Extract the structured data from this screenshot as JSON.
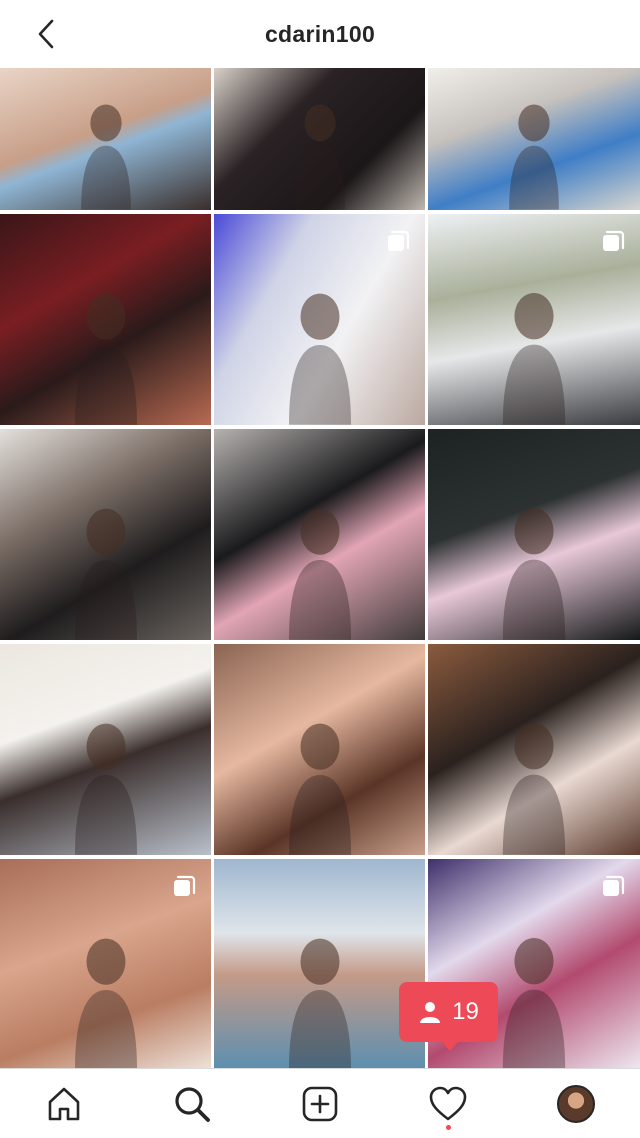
{
  "header": {
    "username": "cdarin100",
    "back_icon": "chevron-left-icon"
  },
  "grid": {
    "tiles": [
      {
        "bg": "linear-gradient(160deg,#e9d4c6 0%,#c89f88 45%,#8fb5d4 55%,#3a2e2a 100%)",
        "multi": false
      },
      {
        "bg": "linear-gradient(135deg,#d8d0c8 0%,#2a2224 35%,#1b1618 70%,#bfb8b0 100%)",
        "multi": false
      },
      {
        "bg": "linear-gradient(160deg,#f1efea 0%,#c7c2bd 35%,#3f7ec6 65%,#d9d6d0 100%)",
        "multi": false
      },
      {
        "bg": "linear-gradient(150deg,#3a1618 0%,#7a1e22 35%,#2a1a1a 60%,#b86a52 100%)",
        "multi": false
      },
      {
        "bg": "linear-gradient(120deg,#4a4ad8 0%,#cfd3e6 30%,#f2f2f4 60%,#bba8a0 100%)",
        "multi": true
      },
      {
        "bg": "linear-gradient(170deg,#eef1f4 0%,#a9b09a 35%,#e6e7e8 60%,#3a3c40 100%)",
        "multi": true
      },
      {
        "bg": "linear-gradient(150deg,#e4e0dc 0%,#7b6e66 35%,#1e1c1d 65%,#6b6560 100%)",
        "multi": false
      },
      {
        "bg": "linear-gradient(150deg,#b6b2b0 0%,#1a1a1c 40%,#e2a5b5 60%,#3f3b3a 100%)",
        "multi": false
      },
      {
        "bg": "linear-gradient(160deg,#1d2322 0%,#2c3131 40%,#e8c8d8 60%,#141818 100%)",
        "multi": false
      },
      {
        "bg": "linear-gradient(160deg,#ece7e0 0%,#f4f2ee 35%,#3a2e2c 55%,#b9c0ca 100%)",
        "multi": false
      },
      {
        "bg": "linear-gradient(150deg,#8a6452 0%,#e6b8a0 40%,#5a3426 70%,#c9a08c 100%)",
        "multi": false
      },
      {
        "bg": "linear-gradient(150deg,#8b5b3e 0%,#2a211e 40%,#e9d9d2 65%,#5a3a2c 100%)",
        "multi": false
      },
      {
        "bg": "linear-gradient(160deg,#a96e58 0%,#d9a58c 40%,#b97d62 70%,#efe3da 100%)",
        "multi": true
      },
      {
        "bg": "linear-gradient(180deg,#9fb6cf 0%,#dfe5ea 35%,#c49a88 55%,#5b8fb0 100%)",
        "multi": false
      },
      {
        "bg": "linear-gradient(150deg,#3e2f6a 0%,#e3d9ec 35%,#b24a6e 60%,#efe9f2 100%)",
        "multi": true
      }
    ]
  },
  "activity": {
    "count": "19",
    "icon": "person-icon",
    "color": "#ed4956"
  },
  "tabbar": {
    "items": [
      {
        "name": "home",
        "icon": "home-icon"
      },
      {
        "name": "search",
        "icon": "search-icon"
      },
      {
        "name": "create",
        "icon": "add-post-icon"
      },
      {
        "name": "activity",
        "icon": "heart-icon"
      },
      {
        "name": "profile",
        "icon": "profile-avatar"
      }
    ]
  }
}
